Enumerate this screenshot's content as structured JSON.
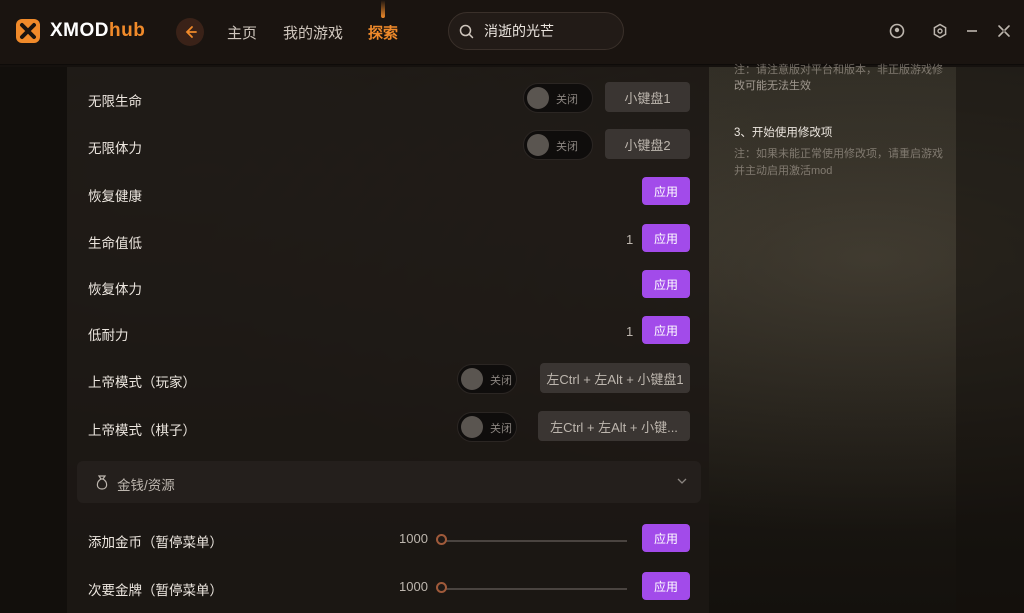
{
  "app": {
    "logo_main": "XMOD",
    "logo_accent": "hub",
    "brand_color": "#f08a2a",
    "accent_color": "#a24bea"
  },
  "nav": {
    "home": "主页",
    "my_games": "我的游戏",
    "explore": "探索"
  },
  "search": {
    "value": "消逝的光芒"
  },
  "rows": [
    {
      "label": "无限生命",
      "toggle": "关闭",
      "key": "小键盘1"
    },
    {
      "label": "无限体力",
      "toggle": "关闭",
      "key": "小键盘2"
    },
    {
      "label": "恢复健康",
      "apply": "应用"
    },
    {
      "label": "生命值低",
      "count": "1",
      "apply": "应用"
    },
    {
      "label": "恢复体力",
      "apply": "应用"
    },
    {
      "label": "低耐力",
      "count": "1",
      "apply": "应用"
    },
    {
      "label": "上帝模式（玩家）",
      "toggle": "关闭",
      "key": "左Ctrl + 左Alt + 小键盘1"
    },
    {
      "label": "上帝模式（棋子）",
      "toggle": "关闭",
      "key": "左Ctrl + 左Alt + 小键..."
    }
  ],
  "section": {
    "label": "金钱/资源"
  },
  "slider_rows": [
    {
      "label": "添加金币（暂停菜单）",
      "value": "1000",
      "level": 0,
      "apply": "应用"
    },
    {
      "label": "次要金牌（暂停菜单）",
      "value": "1000",
      "level": 0,
      "apply": "应用"
    }
  ],
  "info": {
    "line1": "注：请注意版对平台和版本，非正版游戏修",
    "line2": "改可能无法生效",
    "step3_title": "3、开始使用修改项",
    "step3_line1": "注：如果未能正常使用修改项，请重启游戏",
    "step3_line2": "并主动启用激活mod"
  }
}
